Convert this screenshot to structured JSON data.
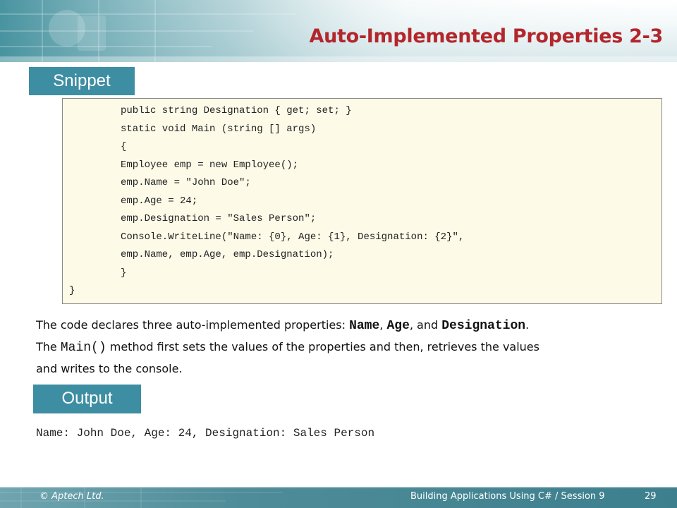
{
  "slide": {
    "title": "Auto-Implemented Properties 2-3"
  },
  "sections": {
    "snippet_label": "Snippet",
    "output_label": "Output"
  },
  "code": {
    "lines": [
      "public string Designation { get; set; }",
      "static void Main (string [] args)",
      "{",
      "Employee emp = new Employee();",
      "emp.Name = \"John Doe\";",
      "emp.Age = 24;",
      "emp.Designation = \"Sales Person\";",
      "Console.WriteLine(\"Name: {0}, Age: {1}, Designation: {2}\",",
      "emp.Name, emp.Age, emp.Designation);",
      "}",
      "}"
    ]
  },
  "description": {
    "line1_text": "The code declares three auto-implemented properties: ",
    "prop_name": "Name",
    "sep1": ", ",
    "prop_age": "Age",
    "sep2": ", and ",
    "prop_designation": "Designation",
    "period": ".",
    "line2_prefix": "The ",
    "method_name": "Main()",
    "line2_text": " method first sets the values of the properties and then, retrieves the values",
    "line3_text": "and writes to the console."
  },
  "output": {
    "text": "Name: John Doe, Age: 24, Designation: Sales Person"
  },
  "footer": {
    "copyright": "© Aptech Ltd.",
    "course": "Building Applications Using C# / Session 9",
    "page_number": "29"
  },
  "colors": {
    "title": "#b3262b",
    "tab_bg": "#3e8ea3",
    "code_bg": "#fdfae8",
    "footer_bg": "#4f8c99"
  }
}
